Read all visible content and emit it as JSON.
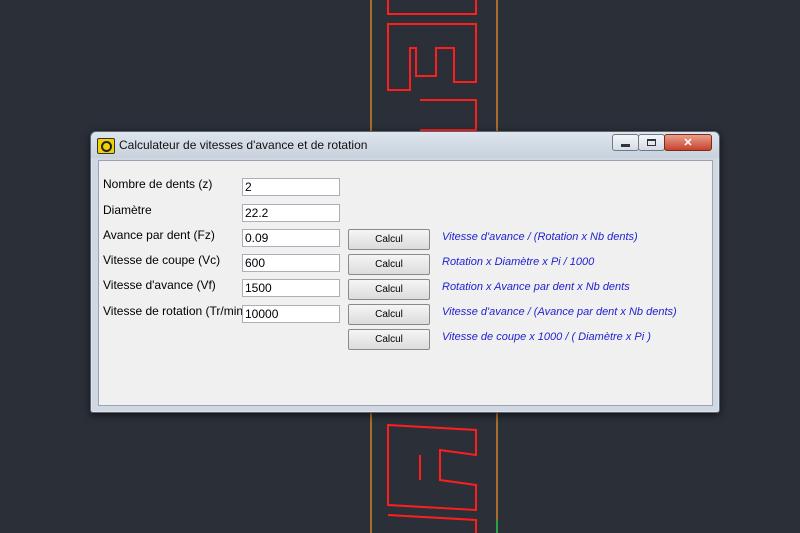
{
  "window": {
    "title": "Calculateur de vitesses d'avance et de rotation"
  },
  "colors": {
    "cad_background": "#2b2f38",
    "cad_text": "#ff1e1e",
    "cad_guide": "#d0822a",
    "formula_text": "#1f1fd0"
  },
  "rows": [
    {
      "label": "Nombre de dents (z)",
      "value": "2"
    },
    {
      "label": "Diamètre",
      "value": "22.2"
    },
    {
      "label": "Avance par dent (Fz)",
      "value": "0.09",
      "button": "Calcul",
      "formula": "Vitesse d'avance / (Rotation x Nb dents)"
    },
    {
      "label": "Vitesse de coupe (Vc)",
      "value": "600",
      "button": "Calcul",
      "formula": "Rotation x Diamètre x Pi / 1000"
    },
    {
      "label": "Vitesse d'avance (Vf)",
      "value": "1500",
      "button": "Calcul",
      "formula": "Rotation x Avance par dent x Nb dents"
    },
    {
      "label": "Vitesse de rotation (Tr/min)",
      "value": "10000",
      "button": "Calcul",
      "formula": "Vitesse d'avance / (Avance par dent x Nb dents)"
    },
    {
      "button": "Calcul",
      "formula": "Vitesse de coupe x 1000 / ( Diamètre x Pi )"
    }
  ]
}
